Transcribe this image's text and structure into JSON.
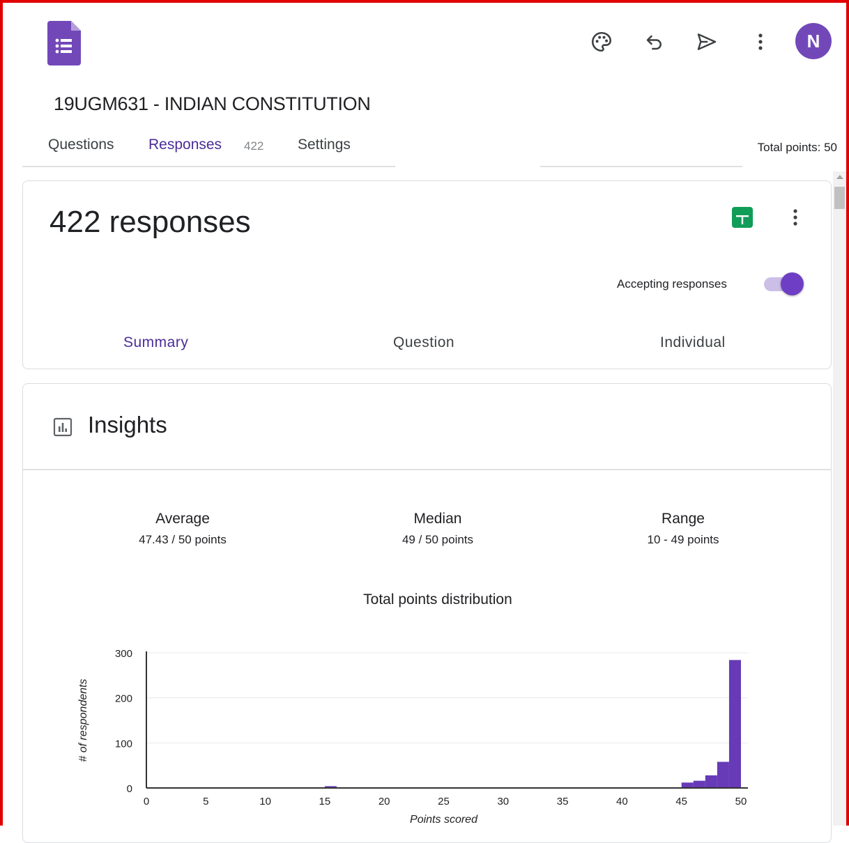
{
  "form": {
    "title": "19UGM631 - INDIAN CONSTITUTION",
    "avatar_letter": "N"
  },
  "icons": {
    "logo": "google-forms-icon",
    "palette": "palette-icon",
    "undo": "undo-icon",
    "send": "send-icon",
    "more": "more-vert-icon",
    "sheets": "google-sheets-icon",
    "insights": "bar-chart-icon"
  },
  "tabs": [
    {
      "label": "Questions",
      "active": false
    },
    {
      "label": "Responses",
      "active": true,
      "count": "422"
    },
    {
      "label": "Settings",
      "active": false
    }
  ],
  "total_points": "Total points: 50",
  "responses_card": {
    "count_label": "422 responses",
    "accepting_label": "Accepting responses",
    "accepting_on": true,
    "sub_tabs": [
      {
        "label": "Summary",
        "active": true
      },
      {
        "label": "Question",
        "active": false
      },
      {
        "label": "Individual",
        "active": false
      }
    ]
  },
  "insights": {
    "title": "Insights",
    "stats": [
      {
        "label": "Average",
        "value": "47.43 / 50 points"
      },
      {
        "label": "Median",
        "value": "49 / 50 points"
      },
      {
        "label": "Range",
        "value": "10 - 49 points"
      }
    ]
  },
  "colors": {
    "accent": "#673ab7",
    "bar": "#673ab7",
    "sheets_green": "#0f9d58",
    "frame_red": "#e10000"
  },
  "chart_data": {
    "type": "bar",
    "title": "Total points distribution",
    "xlabel": "Points scored",
    "ylabel": "# of respondents",
    "xlim": [
      0,
      50
    ],
    "ylim": [
      0,
      300
    ],
    "xticks": [
      0,
      5,
      10,
      15,
      20,
      25,
      30,
      35,
      40,
      45,
      50
    ],
    "yticks": [
      0,
      100,
      200,
      300
    ],
    "grid": true,
    "x": [
      15,
      45,
      46,
      47,
      48,
      49
    ],
    "values": [
      4,
      12,
      16,
      28,
      58,
      284
    ]
  }
}
